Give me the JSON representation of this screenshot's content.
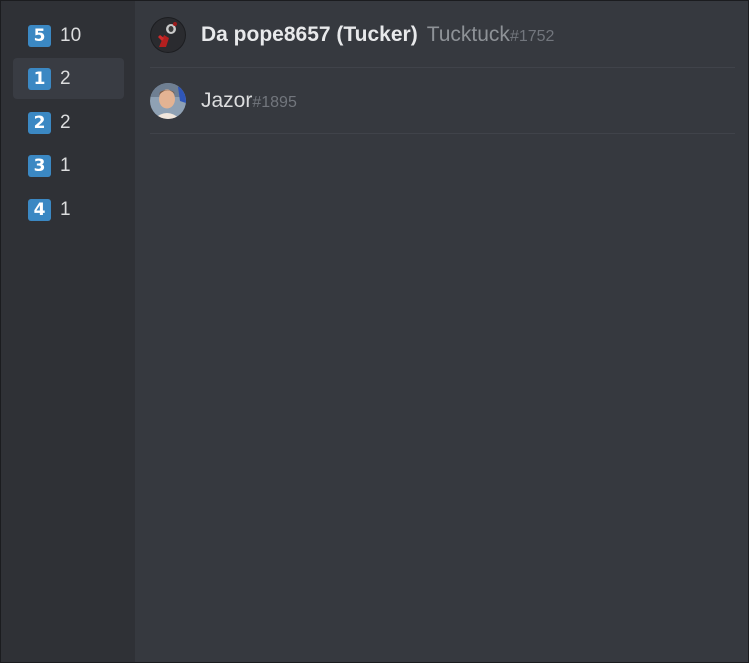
{
  "colors": {
    "sidebar_bg": "#2f3136",
    "main_bg": "#36393f",
    "selected_bg": "#393c43",
    "keycap_blue": "#3b88c3",
    "divider": "#40434a"
  },
  "reactions": [
    {
      "emoji": "keycap-5",
      "glyph": "5",
      "count": "10",
      "selected": false
    },
    {
      "emoji": "keycap-1",
      "glyph": "1",
      "count": "2",
      "selected": true
    },
    {
      "emoji": "keycap-2",
      "glyph": "2",
      "count": "2",
      "selected": false
    },
    {
      "emoji": "keycap-3",
      "glyph": "3",
      "count": "1",
      "selected": false
    },
    {
      "emoji": "keycap-4",
      "glyph": "4",
      "count": "1",
      "selected": false
    }
  ],
  "users": [
    {
      "avatar": "dark-avatar-red-figure",
      "nickname": "Da pope8657 (Tucker)",
      "username": "Tucktuck",
      "discriminator": "#1752"
    },
    {
      "avatar": "photo-avatar-person",
      "nickname": "",
      "username": "Jazor",
      "discriminator": "#1895"
    }
  ]
}
